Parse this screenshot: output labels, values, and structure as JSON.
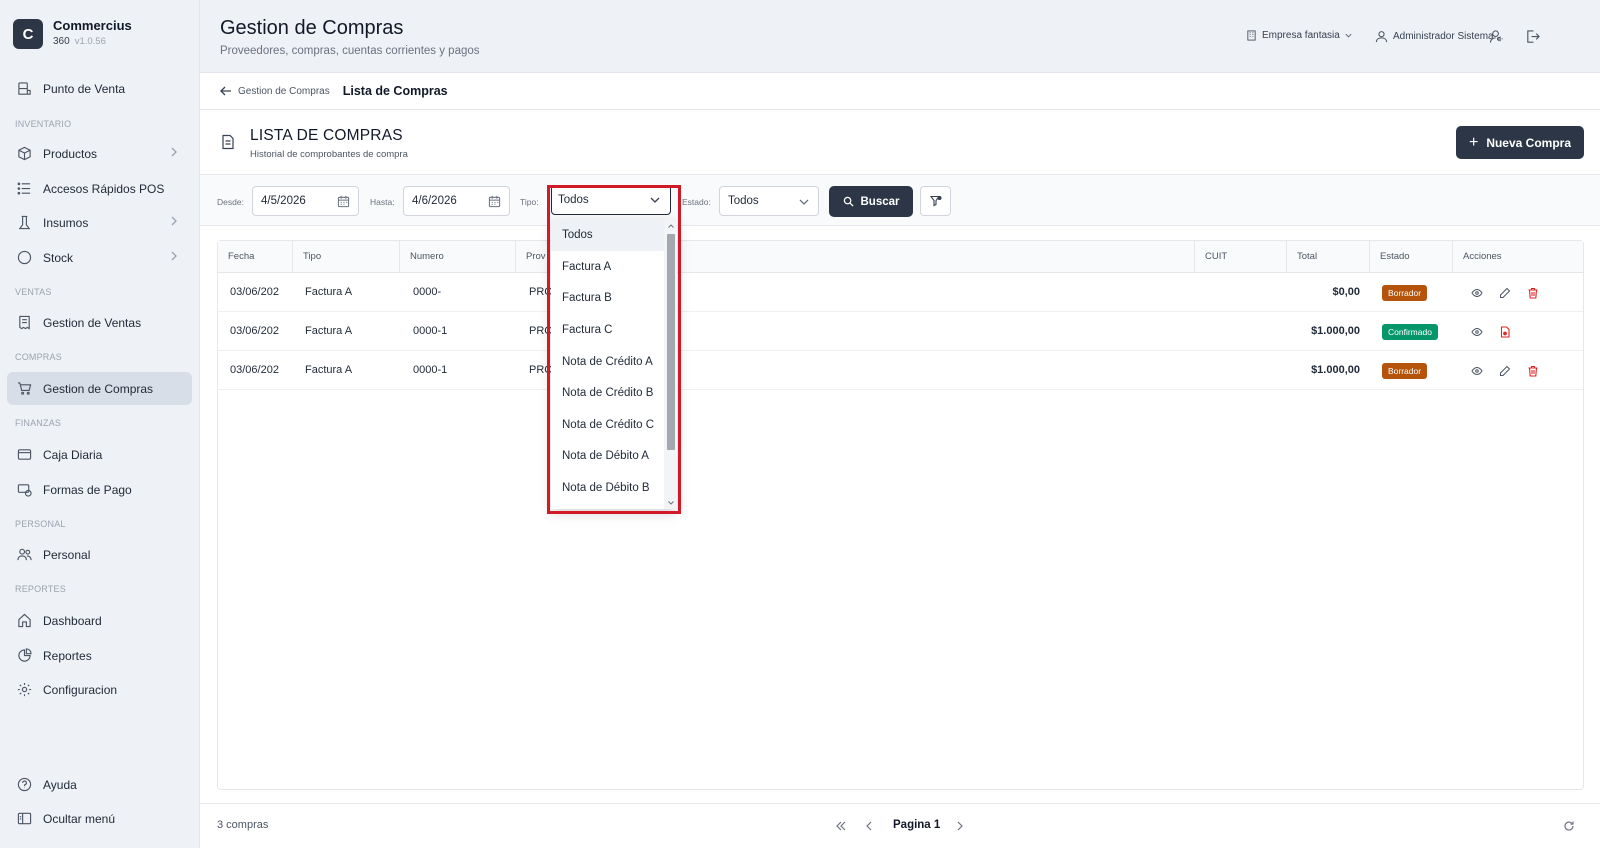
{
  "brand": {
    "logo_letter": "C",
    "name": "Commercius",
    "sub": "360",
    "version": "v1.0.56"
  },
  "sidebar": {
    "items": [
      {
        "label": "Punto de Venta",
        "icon": "pos-icon"
      },
      {
        "label": "Productos",
        "icon": "box-icon"
      },
      {
        "label": "Accesos Rápidos POS",
        "icon": "list-icon"
      },
      {
        "label": "Insumos",
        "icon": "flask-icon"
      },
      {
        "label": "Stock",
        "icon": "circle-icon"
      },
      {
        "label": "Gestion de Ventas",
        "icon": "receipt-icon"
      },
      {
        "label": "Gestion de Compras",
        "icon": "cart-icon"
      },
      {
        "label": "Caja Diaria",
        "icon": "wallet-icon"
      },
      {
        "label": "Formas de Pago",
        "icon": "card-icon"
      },
      {
        "label": "Personal",
        "icon": "users-icon"
      },
      {
        "label": "Dashboard",
        "icon": "home-icon"
      },
      {
        "label": "Reportes",
        "icon": "chart-icon"
      },
      {
        "label": "Configuracion",
        "icon": "gear-icon"
      },
      {
        "label": "Ayuda",
        "icon": "help-icon"
      },
      {
        "label": "Ocultar menú",
        "icon": "sidebar-icon"
      }
    ],
    "sections": [
      "INVENTARIO",
      "VENTAS",
      "COMPRAS",
      "FINANZAS",
      "PERSONAL",
      "REPORTES"
    ]
  },
  "header": {
    "title": "Gestion de Compras",
    "subtitle": "Proveedores, compras, cuentas corrientes y pagos",
    "company": "Empresa fantasia",
    "user": "Administrador Sistema"
  },
  "breadcrumb": {
    "back": "Gestion de Compras",
    "current": "Lista de Compras"
  },
  "list": {
    "title": "LISTA DE COMPRAS",
    "subtitle": "Historial de comprobantes de compra",
    "new_button": "Nueva Compra"
  },
  "filters": {
    "desde_label": "Desde:",
    "desde_value": "4/5/2026",
    "hasta_label": "Hasta:",
    "hasta_value": "4/6/2026",
    "tipo_label": "Tipo:",
    "tipo_value": "Todos",
    "estado_label": "Estado:",
    "estado_value": "Todos",
    "buscar": "Buscar"
  },
  "table": {
    "headers": [
      "Fecha",
      "Tipo",
      "Numero",
      "Prov",
      "CUIT",
      "Total",
      "Estado",
      "Acciones"
    ],
    "rows": [
      {
        "fecha": "03/06/202",
        "tipo": "Factura A",
        "numero": "0000-",
        "prov": "PRC",
        "total": "$0,00",
        "estado": "Borrador"
      },
      {
        "fecha": "03/06/202",
        "tipo": "Factura A",
        "numero": "0000-1",
        "prov": "PRC",
        "total": "$1.000,00",
        "estado": "Confirmado"
      },
      {
        "fecha": "03/06/202",
        "tipo": "Factura A",
        "numero": "0000-1",
        "prov": "PRC",
        "total": "$1.000,00",
        "estado": "Borrador"
      }
    ]
  },
  "dropdown": {
    "options": [
      "Todos",
      "Factura A",
      "Factura B",
      "Factura C",
      "Nota de Crédito A",
      "Nota de Crédito B",
      "Nota de Crédito C",
      "Nota de Débito A",
      "Nota de Débito B"
    ],
    "selected": "Todos"
  },
  "footer": {
    "count": "3 compras",
    "page": "Pagina 1"
  },
  "colors": {
    "primary": "#2c3646",
    "borrador": "#b45309",
    "confirmado": "#059669",
    "delete": "#dc2626",
    "highlight": "#d11a26"
  }
}
